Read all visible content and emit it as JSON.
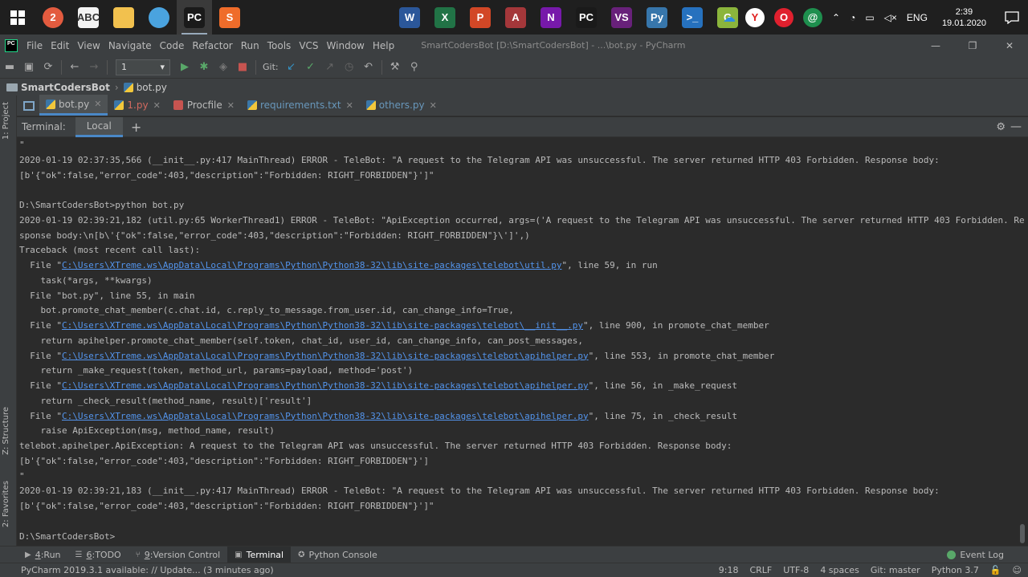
{
  "taskbar": {
    "apps": [
      {
        "name": "chrome",
        "label": "2",
        "color": "#e35b3f",
        "round": true
      },
      {
        "name": "abc",
        "label": "ABC",
        "color": "#f3f3f3",
        "text": "#333"
      },
      {
        "name": "explorer",
        "label": "",
        "color": "#f2c14e"
      },
      {
        "name": "telegram-app",
        "label": "",
        "color": "#4aa3df",
        "round": true
      },
      {
        "name": "pycharm",
        "label": "PC",
        "color": "#1a1a1a",
        "active": true
      },
      {
        "name": "sublime",
        "label": "S",
        "color": "#ef6c2a"
      }
    ],
    "pinned": [
      {
        "name": "word",
        "label": "W",
        "color": "#2b579a"
      },
      {
        "name": "excel",
        "label": "X",
        "color": "#217346"
      },
      {
        "name": "powerpoint",
        "label": "P",
        "color": "#d24726"
      },
      {
        "name": "access",
        "label": "A",
        "color": "#a4373a"
      },
      {
        "name": "onenote",
        "label": "N",
        "color": "#7719aa"
      },
      {
        "name": "pycharm-pinned",
        "label": "PC",
        "color": "#1a1a1a"
      },
      {
        "name": "visual-studio",
        "label": "VS",
        "color": "#68217a"
      },
      {
        "name": "python",
        "label": "Py",
        "color": "#3776ab"
      },
      {
        "name": "powershell",
        "label": ">_",
        "color": "#2671be"
      },
      {
        "name": "git-gui",
        "label": "G",
        "color": "#8bb53c"
      }
    ],
    "lang": "ENG",
    "time": "2:39",
    "date": "19.01.2020"
  },
  "menubar": {
    "items": [
      "File",
      "Edit",
      "View",
      "Navigate",
      "Code",
      "Refactor",
      "Run",
      "Tools",
      "VCS",
      "Window",
      "Help"
    ],
    "window_title": "SmartCodersBot [D:\\SmartCodersBot] - ...\\bot.py - PyCharm"
  },
  "toolbar": {
    "run_config": "1",
    "git_label": "Git:"
  },
  "breadcrumb": {
    "project": "SmartCodersBot",
    "file": "bot.py"
  },
  "sidebar": {
    "project_tab": "1: Project",
    "structure_tab": "Z: Structure",
    "favorites_tab": "2: Favorites"
  },
  "tabs": [
    {
      "label": "bot.py",
      "active": true,
      "style": "blue"
    },
    {
      "label": "1.py",
      "style": "red"
    },
    {
      "label": "Procfile",
      "style": "plain"
    },
    {
      "label": "requirements.txt",
      "style": "blue"
    },
    {
      "label": "others.py",
      "style": "blue"
    }
  ],
  "terminal": {
    "title": "Terminal:",
    "tab": "Local",
    "lines": [
      "\"",
      "2020-01-19 02:37:35,566 (__init__.py:417 MainThread) ERROR - TeleBot: \"A request to the Telegram API was unsuccessful. The server returned HTTP 403 Forbidden. Response body:",
      "[b'{\"ok\":false,\"error_code\":403,\"description\":\"Forbidden: RIGHT_FORBIDDEN\"}']\"",
      "",
      "D:\\SmartCodersBot>python bot.py",
      "2020-01-19 02:39:21,182 (util.py:65 WorkerThread1) ERROR - TeleBot: \"ApiException occurred, args=('A request to the Telegram API was unsuccessful. The server returned HTTP 403 Forbidden. Re",
      "sponse body:\\n[b\\'{\"ok\":false,\"error_code\":403,\"description\":\"Forbidden: RIGHT_FORBIDDEN\"}\\']',)",
      "Traceback (most recent call last):",
      {
        "pre": "  File \"",
        "link": "C:\\Users\\XTreme.ws\\AppData\\Local\\Programs\\Python\\Python38-32\\lib\\site-packages\\telebot\\util.py",
        "post": "\", line 59, in run"
      },
      "    task(*args, **kwargs)",
      "  File \"bot.py\", line 55, in main",
      "    bot.promote_chat_member(c.chat.id, c.reply_to_message.from_user.id, can_change_info=True,",
      {
        "pre": "  File \"",
        "link": "C:\\Users\\XTreme.ws\\AppData\\Local\\Programs\\Python\\Python38-32\\lib\\site-packages\\telebot\\__init__.py",
        "post": "\", line 900, in promote_chat_member"
      },
      "    return apihelper.promote_chat_member(self.token, chat_id, user_id, can_change_info, can_post_messages,",
      {
        "pre": "  File \"",
        "link": "C:\\Users\\XTreme.ws\\AppData\\Local\\Programs\\Python\\Python38-32\\lib\\site-packages\\telebot\\apihelper.py",
        "post": "\", line 553, in promote_chat_member"
      },
      "    return _make_request(token, method_url, params=payload, method='post')",
      {
        "pre": "  File \"",
        "link": "C:\\Users\\XTreme.ws\\AppData\\Local\\Programs\\Python\\Python38-32\\lib\\site-packages\\telebot\\apihelper.py",
        "post": "\", line 56, in _make_request"
      },
      "    return _check_result(method_name, result)['result']",
      {
        "pre": "  File \"",
        "link": "C:\\Users\\XTreme.ws\\AppData\\Local\\Programs\\Python\\Python38-32\\lib\\site-packages\\telebot\\apihelper.py",
        "post": "\", line 75, in _check_result"
      },
      "    raise ApiException(msg, method_name, result)",
      "telebot.apihelper.ApiException: A request to the Telegram API was unsuccessful. The server returned HTTP 403 Forbidden. Response body:",
      "[b'{\"ok\":false,\"error_code\":403,\"description\":\"Forbidden: RIGHT_FORBIDDEN\"}']",
      "\"",
      "2020-01-19 02:39:21,183 (__init__.py:417 MainThread) ERROR - TeleBot: \"A request to the Telegram API was unsuccessful. The server returned HTTP 403 Forbidden. Response body:",
      "[b'{\"ok\":false,\"error_code\":403,\"description\":\"Forbidden: RIGHT_FORBIDDEN\"}']\"",
      "",
      "D:\\SmartCodersBot>"
    ]
  },
  "bottombar": {
    "tools": [
      {
        "num": "4",
        "label": "Run",
        "icon": "▶"
      },
      {
        "num": "6",
        "label": "TODO",
        "icon": "☰"
      },
      {
        "num": "9",
        "label": "Version Control",
        "icon": "⑂"
      },
      {
        "num": "",
        "label": "Terminal",
        "icon": "▣",
        "active": true
      },
      {
        "num": "",
        "label": "Python Console",
        "icon": "✪"
      }
    ],
    "event_log": "Event Log"
  },
  "statusbar": {
    "message": "PyCharm 2019.3.1 available: // Update... (3 minutes ago)",
    "position": "9:18",
    "line_sep": "CRLF",
    "encoding": "UTF-8",
    "indent": "4 spaces",
    "git": "Git: master",
    "interpreter": "Python 3.7"
  }
}
